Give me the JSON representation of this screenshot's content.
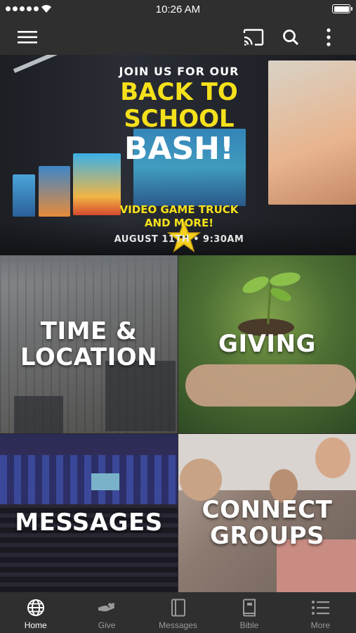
{
  "status_bar": {
    "time": "10:26 AM"
  },
  "hero": {
    "line1": "JOIN US FOR OUR",
    "line2a": "BACK TO",
    "line2b": "SCHOOL",
    "line3": "BASH!",
    "line4a": "VIDEO GAME TRUCK",
    "line4b": "AND MORE!",
    "line5": "AUGUST 11TH • 9:30AM"
  },
  "tiles": {
    "time_location": "TIME &\nLOCATION",
    "giving": "GIVING",
    "messages": "MESSAGES",
    "connect_groups": "CONNECT\nGROUPS"
  },
  "tabs": [
    {
      "label": "Home",
      "icon": "globe-icon",
      "active": true
    },
    {
      "label": "Give",
      "icon": "hand-icon",
      "active": false
    },
    {
      "label": "Messages",
      "icon": "book-icon",
      "active": false
    },
    {
      "label": "Bible",
      "icon": "bible-icon",
      "active": false
    },
    {
      "label": "More",
      "icon": "list-icon",
      "active": false
    }
  ],
  "colors": {
    "accent_yellow": "#f5e11b",
    "bar_bg": "#2f2f2f"
  }
}
